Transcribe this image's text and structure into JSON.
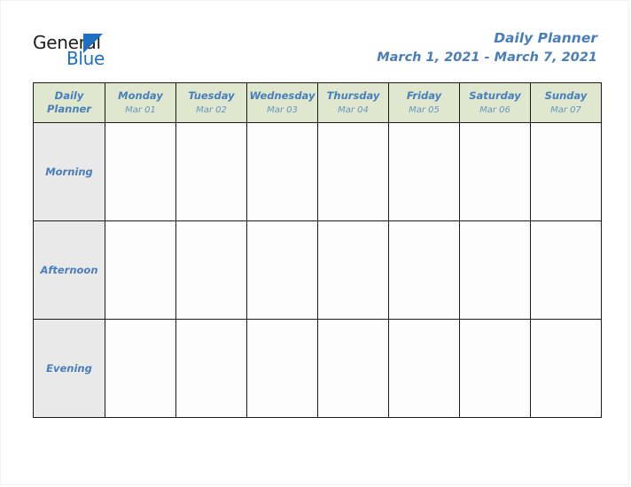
{
  "logo": {
    "primary_text": "General",
    "secondary_text": "Blue",
    "triangle_icon": "triangle-icon",
    "primary_color": "#1c1c1c",
    "secondary_color": "#1f6fc0"
  },
  "header": {
    "title": "Daily Planner",
    "date_range": "March 1, 2021 - March 7, 2021",
    "title_color": "#4a7ebb"
  },
  "planner": {
    "corner_label_line1": "Daily",
    "corner_label_line2": "Planner",
    "header_background": "#dfe8ce",
    "label_background": "#e9e9e9",
    "cell_background": "#fdfdfd",
    "border_color": "#1a1a1a",
    "days": [
      {
        "name": "Monday",
        "date": "Mar 01"
      },
      {
        "name": "Tuesday",
        "date": "Mar 02"
      },
      {
        "name": "Wednesday",
        "date": "Mar 03"
      },
      {
        "name": "Thursday",
        "date": "Mar 04"
      },
      {
        "name": "Friday",
        "date": "Mar 05"
      },
      {
        "name": "Saturday",
        "date": "Mar 06"
      },
      {
        "name": "Sunday",
        "date": "Mar 07"
      }
    ],
    "time_slots": [
      {
        "label": "Morning",
        "entries": [
          "",
          "",
          "",
          "",
          "",
          "",
          ""
        ]
      },
      {
        "label": "Afternoon",
        "entries": [
          "",
          "",
          "",
          "",
          "",
          "",
          ""
        ]
      },
      {
        "label": "Evening",
        "entries": [
          "",
          "",
          "",
          "",
          "",
          "",
          ""
        ]
      }
    ]
  }
}
